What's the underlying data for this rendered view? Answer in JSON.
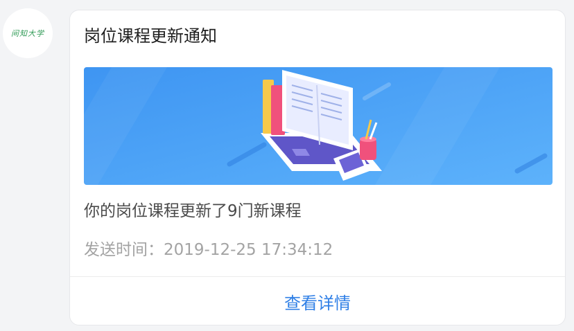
{
  "avatar": {
    "text": "间知大学"
  },
  "card": {
    "title": "岗位课程更新通知",
    "message": "你的岗位课程更新了9门新课程",
    "send_time": "发送时间：2019-12-25 17:34:12",
    "details_label": "查看详情"
  },
  "colors": {
    "page_bg": "#f3f4f6",
    "card_bg": "#ffffff",
    "banner_blue": "#4aa0f5",
    "link_blue": "#2f7fe6",
    "avatar_text_green": "#2f9a55"
  },
  "banner": {
    "image": "laptop-book-illustration"
  }
}
